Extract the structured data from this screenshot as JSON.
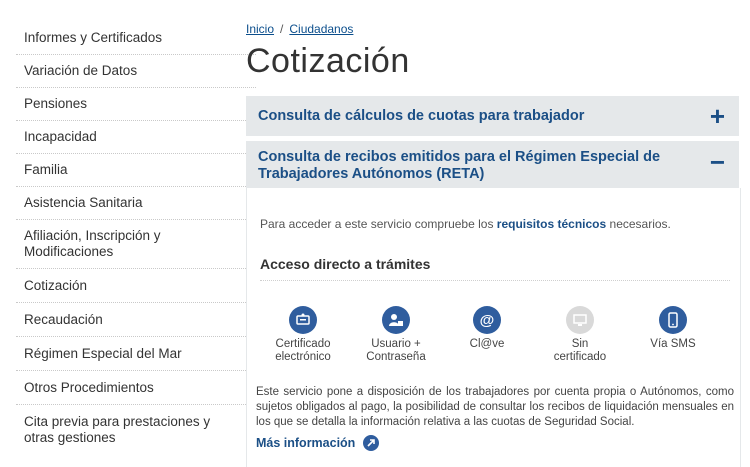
{
  "sidebar": {
    "items": [
      {
        "label": "Informes y Certificados"
      },
      {
        "label": "Variación de Datos"
      },
      {
        "label": "Pensiones"
      },
      {
        "label": "Incapacidad"
      },
      {
        "label": "Familia"
      },
      {
        "label": "Asistencia Sanitaria"
      },
      {
        "label": "Afiliación, Inscripción y Modificaciones"
      },
      {
        "label": "Cotización"
      },
      {
        "label": "Recaudación"
      },
      {
        "label": "Régimen Especial del Mar"
      },
      {
        "label": "Otros Procedimientos"
      },
      {
        "label": "Cita previa para prestaciones y otras gestiones"
      }
    ]
  },
  "breadcrumb": {
    "home": "Inicio",
    "sep": "/",
    "current": "Ciudadanos"
  },
  "page": {
    "title": "Cotización"
  },
  "accordion": {
    "first": {
      "title": "Consulta de cálculos de cuotas para trabajador",
      "toggle": "+"
    },
    "second": {
      "title": "Consulta de recibos emitidos para el Régimen Especial de Trabajadores Autónomos (RETA)",
      "toggle": "−"
    }
  },
  "body": {
    "req_prefix": "Para acceder a este servicio compruebe los",
    "req_link": "requisitos técnicos",
    "req_suffix": "necesarios.",
    "section_title": "Acceso directo a trámites",
    "methods": [
      {
        "line1": "Certificado",
        "line2": "electrónico",
        "icon": "certificate-icon",
        "enabled": true
      },
      {
        "line1": "Usuario +",
        "line2": "Contraseña",
        "icon": "user-lock-icon",
        "enabled": true
      },
      {
        "line1": "Cl@ve",
        "line2": "",
        "icon": "at-icon",
        "enabled": true
      },
      {
        "line1": "Sin",
        "line2": "certificado",
        "icon": "monitor-icon",
        "enabled": false
      },
      {
        "line1": "Vía SMS",
        "line2": "",
        "icon": "mobile-icon",
        "enabled": true
      }
    ],
    "description": "Este servicio pone a disposición de los trabajadores por cuenta propia o Autónomos, como sujetos obligados al pago, la posibilidad de consultar los recibos de liquidación mensuales en los que se detalla la información relativa a las cuotas de Seguridad Social.",
    "more_label": "Más información"
  },
  "colors": {
    "accent": "#1b4f86",
    "icon_bg": "#2f5d9e",
    "header_bg": "#e5e8ea",
    "disabled": "#d9d9d9"
  }
}
